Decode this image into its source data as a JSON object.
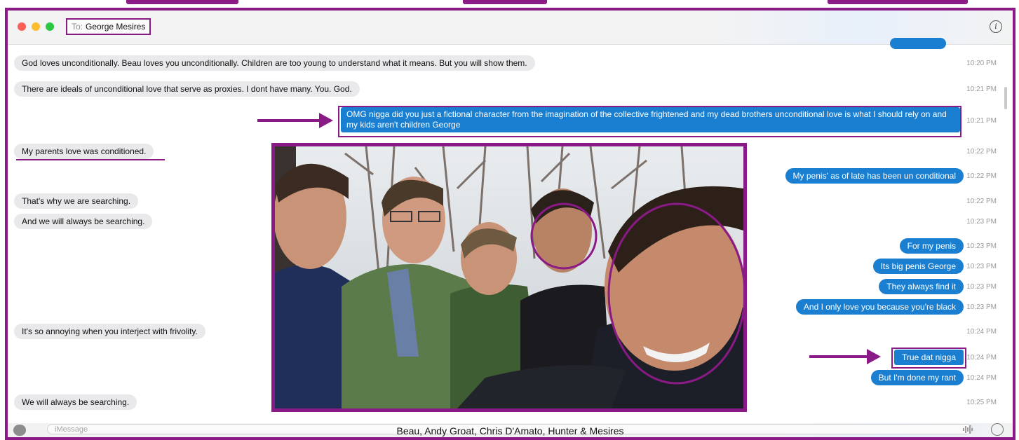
{
  "window": {
    "recipient_prefix": "To:",
    "recipient": "George Mesires",
    "info_icon": "info-icon"
  },
  "messages": [
    {
      "side": "received",
      "text": "God loves unconditionally. Beau loves you unconditionally. Children are too young to understand what it means. But you will show them.",
      "time": "10:20 PM"
    },
    {
      "side": "received",
      "text": "There are ideals of unconditional love that serve as proxies. I dont have many.  You. God.",
      "time": "10:21 PM"
    },
    {
      "side": "sent",
      "text": "OMG nigga did you just a fictional character from the imagination of the collective frightened and my dead brothers unconditional love is what I should rely on and my kids aren't children George",
      "time": "10:21 PM"
    },
    {
      "side": "received",
      "text": "My parents love was conditioned.",
      "time": "10:22 PM"
    },
    {
      "side": "sent",
      "text": "My penis' as of late has been un conditional",
      "time": "10:22 PM"
    },
    {
      "side": "received",
      "text": "That's why we are searching.",
      "time": "10:22 PM"
    },
    {
      "side": "received",
      "text": "And we will always be searching.",
      "time": "10:23 PM"
    },
    {
      "side": "sent",
      "text": "For my penis",
      "time": "10:23 PM"
    },
    {
      "side": "sent",
      "text": "Its big penis George",
      "time": "10:23 PM"
    },
    {
      "side": "sent",
      "text": "They always find it",
      "time": "10:23 PM"
    },
    {
      "side": "sent",
      "text": "And I only love you because you're black",
      "time": "10:23 PM"
    },
    {
      "side": "received",
      "text": "It's so annoying when you interject with frivolity.",
      "time": "10:24 PM"
    },
    {
      "side": "sent",
      "text": "True dat nigga",
      "time": "10:24 PM"
    },
    {
      "side": "sent",
      "text": "But I'm done my rant",
      "time": "10:24 PM"
    },
    {
      "side": "received",
      "text": "We will always be searching.",
      "time": "10:25 PM"
    }
  ],
  "photo": {
    "caption": "Beau, Andy Groat, Chris D'Amato, Hunter & Mesires"
  },
  "input": {
    "placeholder": "iMessage",
    "apps_icon": "app-store-icon",
    "audio_icon": "audio-waveform-icon",
    "emoji_icon": "emoji-icon"
  },
  "colors": {
    "annotation": "#8a1a86",
    "sent_bubble": "#1a7fd0",
    "received_bubble": "#e9e9eb"
  }
}
